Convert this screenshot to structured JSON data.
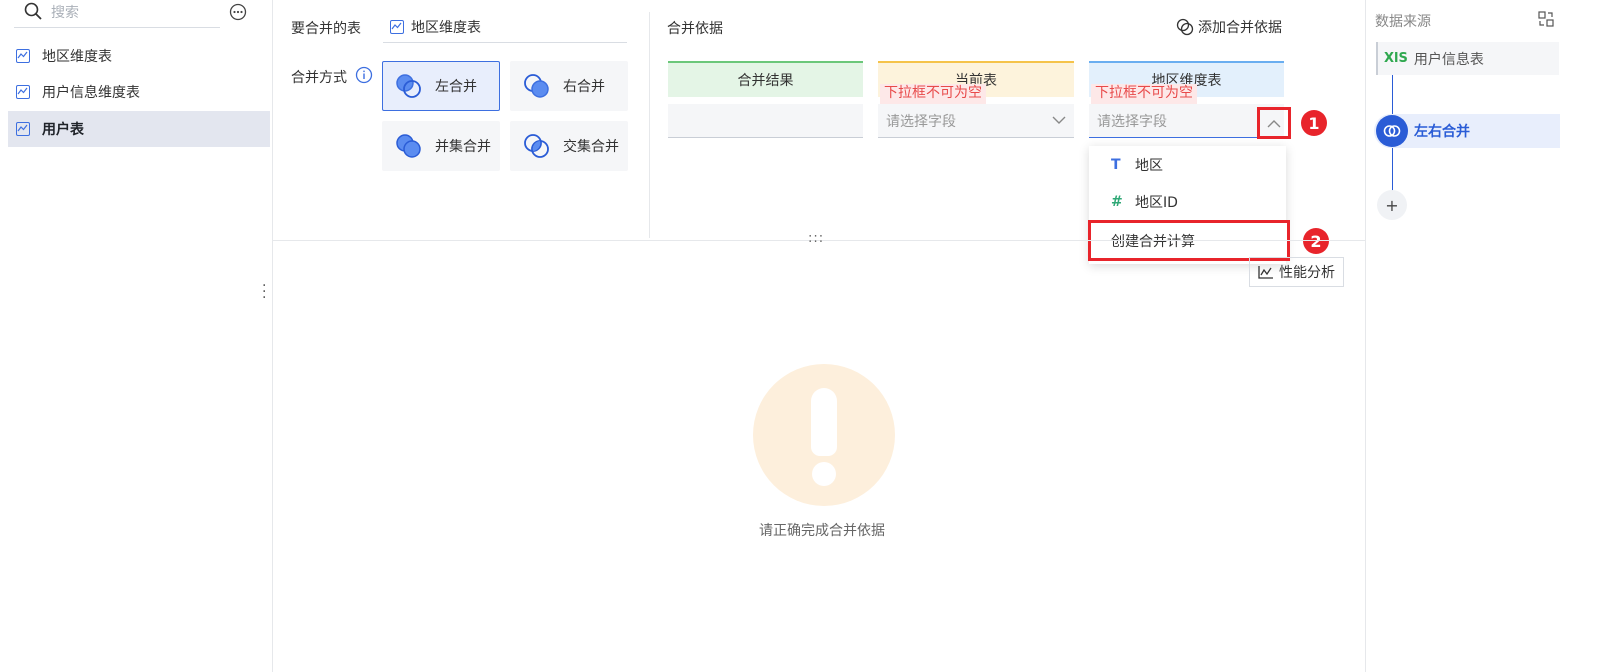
{
  "left_panel": {
    "search_placeholder": "搜索",
    "items": [
      {
        "label": "地区维度表",
        "selected": false
      },
      {
        "label": "用户信息维度表",
        "selected": false
      },
      {
        "label": "用户表",
        "selected": true
      }
    ]
  },
  "merge": {
    "table_label": "要合并的表",
    "table_value": "地区维度表",
    "mode_label": "合并方式",
    "modes": [
      {
        "label": "左合并",
        "active": true
      },
      {
        "label": "右合并",
        "active": false
      },
      {
        "label": "并集合并",
        "active": false
      },
      {
        "label": "交集合并",
        "active": false
      }
    ]
  },
  "basis": {
    "title": "合并依据",
    "add_label": "添加合并依据",
    "columns": [
      {
        "header": "合并结果",
        "color": "#e4f5e6",
        "border": "#6bc77a"
      },
      {
        "header": "当前表",
        "color": "#fdf3dc",
        "border": "#f5c34a"
      },
      {
        "header": "地区维度表",
        "color": "#e3f0fc",
        "border": "#6aaef0"
      }
    ],
    "error_text": "下拉框不可为空",
    "select_placeholder": "请选择字段",
    "dropdown": {
      "options": [
        {
          "icon": "text-type-icon",
          "glyph": "T",
          "label": "地区"
        },
        {
          "icon": "number-type-icon",
          "glyph": "#",
          "label": "地区ID"
        }
      ],
      "create_label": "创建合并计算"
    },
    "badges": [
      "1",
      "2"
    ]
  },
  "toolbar": {
    "perf_label": "性能分析",
    "resize_glyph": ":::"
  },
  "empty_state": {
    "message": "请正确完成合并依据"
  },
  "right_panel": {
    "title": "数据来源",
    "source_badge": "XlS",
    "source_label": "用户信息表",
    "step_label": "左右合并",
    "add_glyph": "+"
  },
  "colors": {
    "accent": "#3d6fe0",
    "error": "#e8242b",
    "warning_bg": "#fdefdc"
  }
}
